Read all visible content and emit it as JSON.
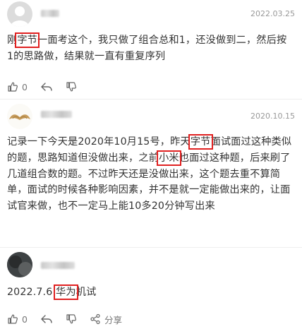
{
  "comments": [
    {
      "date": "2022.03.25",
      "text_pre": "刚",
      "text_hl": "字节",
      "text_post": "一面考这个，我只做了组合总和1，还没做到二，然后按1的思路做，结果就一直有重复序列",
      "likes": "0"
    },
    {
      "date": "2020.10.15",
      "text_pre": "记录一下今天是2020年10月15号，昨天",
      "text_hl": "字节",
      "text_mid": "面试面过这种类似的题，思路知道但没做出来，之前",
      "text_hl2": "小米",
      "text_post": "也面过这种题，后来刷了几道组合数的题。不过昨天还是没做出来，这个题去重不算简单，面试的时候各种影响因素，并不是就一定能做出来的，让面试官来做，也不一定马上能10多20分钟写出来",
      "likes": "0"
    },
    {
      "text_pre": "2022.7.6 ",
      "text_hl": "华为",
      "text_post": "机试",
      "likes": "0",
      "share_label": "分享"
    }
  ],
  "icons": {
    "like": "thumbs-up-icon",
    "reply": "reply-arrow-icon",
    "dislike": "thumbs-down-icon",
    "share": "share-icon"
  },
  "colors": {
    "highlight": "#e02020",
    "date": "#999999",
    "text": "#333333"
  }
}
